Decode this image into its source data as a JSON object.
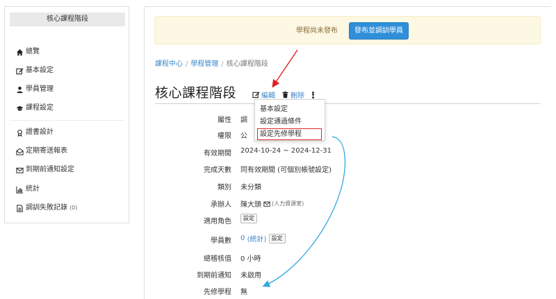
{
  "sidebar": {
    "title": "核心課程階段",
    "items": [
      {
        "label": "總覽"
      },
      {
        "label": "基本設定"
      },
      {
        "label": "學員管理"
      },
      {
        "label": "課程設定"
      },
      {
        "label": "證書設計"
      },
      {
        "label": "定期寄送報表"
      },
      {
        "label": "到期前通知設定"
      },
      {
        "label": "統計"
      },
      {
        "label": "調訓失敗記錄",
        "count": "(0)"
      }
    ]
  },
  "alert": {
    "text": "學程尚未發布",
    "button_label": "發布並調訓學員"
  },
  "breadcrumb": [
    "課程中心",
    "學程管理",
    "核心課程階段"
  ],
  "page": {
    "title": "核心課程階段",
    "edit_label": "編輯",
    "delete_label": "刪除"
  },
  "dropdown": {
    "items": [
      "基本設定",
      "設定通過條件",
      "設定先修學程"
    ]
  },
  "properties": {
    "attr_label": "屬性",
    "attr_value": "調",
    "perm_label": "權限",
    "perm_value": "公",
    "period_label": "有效期間",
    "period_value": "2024-10-24 ~ 2024-12-31",
    "days_label": "完成天數",
    "days_value": "同有效期間 (可個別帳號設定)",
    "category_label": "類別",
    "category_value": "未分類",
    "organizer_label": "承辦人",
    "organizer_value": "陳大頭",
    "organizer_dept": "(人力資源室)",
    "role_label": "適用角色",
    "role_btn": "設定",
    "learners_label": "學員數",
    "learners_count": "0",
    "learners_stats": "(統計)",
    "learners_btn": "設定",
    "total_label": "總稽核值",
    "total_value": "0 小時",
    "expire_label": "到期前通知",
    "expire_value": "未啟用",
    "prereq_label": "先修學程",
    "prereq_value": "無"
  },
  "colors": {
    "link": "#3a87c8",
    "primary_button": "#2f8fd8",
    "alert_bg": "#fdf8e3",
    "highlight_box": "#d62b2b",
    "red_arrow": "#e02020",
    "blue_arrow": "#2ea7e0"
  }
}
